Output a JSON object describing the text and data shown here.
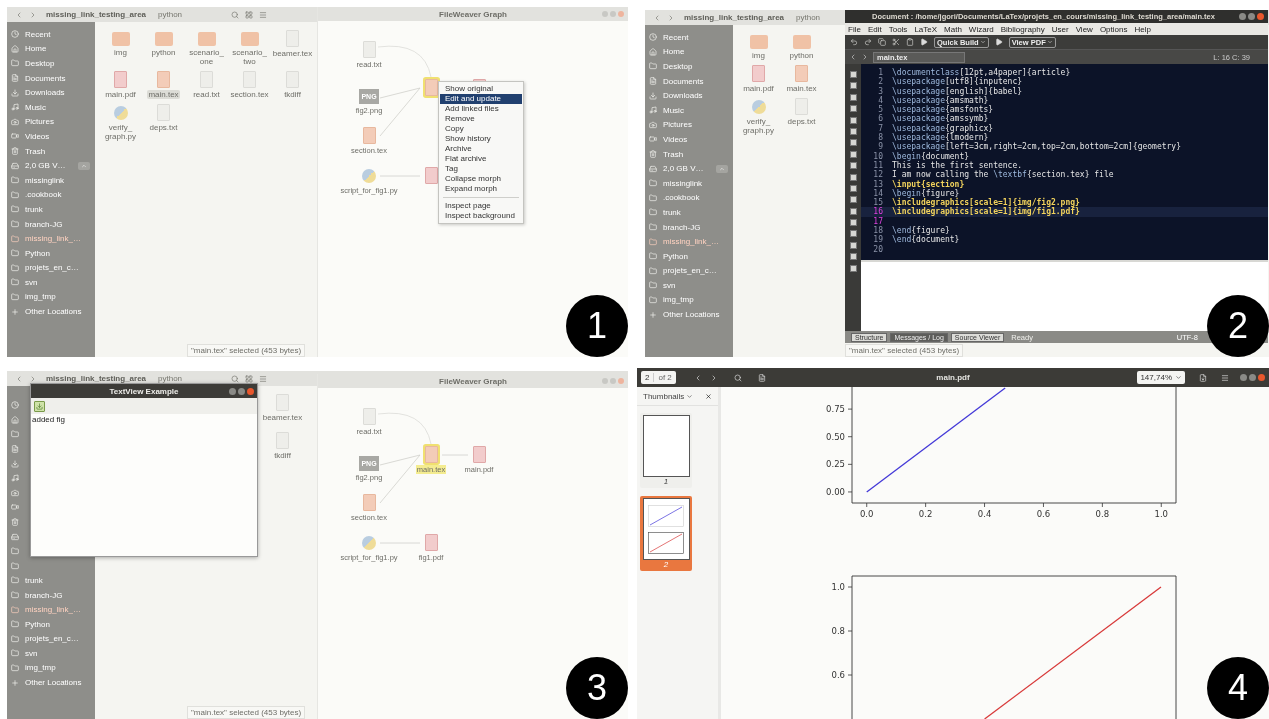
{
  "panels": [
    {
      "kind": "fileweaver",
      "badge": "1",
      "file_manager": {
        "path": [
          "missing_link_testing_area",
          "python"
        ],
        "sidebar": [
          {
            "kind": "place",
            "label": "Recent",
            "selected": false
          },
          {
            "kind": "place",
            "label": "Home",
            "selected": false
          },
          {
            "kind": "place",
            "label": "Desktop",
            "selected": false
          },
          {
            "kind": "place",
            "label": "Documents",
            "selected": false
          },
          {
            "kind": "place",
            "label": "Downloads",
            "selected": false
          },
          {
            "kind": "place",
            "label": "Music",
            "selected": false
          },
          {
            "kind": "place",
            "label": "Pictures",
            "selected": false
          },
          {
            "kind": "place",
            "label": "Videos",
            "selected": false
          },
          {
            "kind": "place",
            "label": "Trash",
            "selected": false
          },
          {
            "kind": "drive",
            "label": "2,0 GB V…",
            "selected": false
          },
          {
            "kind": "folder",
            "label": "missinglink",
            "selected": false
          },
          {
            "kind": "folder",
            "label": ".cookbook",
            "selected": false
          },
          {
            "kind": "folder",
            "label": "trunk",
            "selected": false
          },
          {
            "kind": "folder",
            "label": "branch-JG",
            "selected": false
          },
          {
            "kind": "folder",
            "label": "missing_link_…",
            "selected": true
          },
          {
            "kind": "folder",
            "label": "Python",
            "selected": false
          },
          {
            "kind": "folder",
            "label": "projets_en_c…",
            "selected": false
          },
          {
            "kind": "folder",
            "label": "svn",
            "selected": false
          },
          {
            "kind": "folder",
            "label": "img_tmp",
            "selected": false
          },
          {
            "kind": "add",
            "label": "Other Locations",
            "selected": false
          }
        ],
        "files": [
          {
            "kind": "folder",
            "name": "img",
            "selected": false
          },
          {
            "kind": "folder",
            "name": "python",
            "selected": false
          },
          {
            "kind": "folder",
            "name": "scenario_ one",
            "selected": false
          },
          {
            "kind": "folder",
            "name": "scenario_ two",
            "selected": false
          },
          {
            "kind": "text",
            "name": "beamer.tex",
            "selected": false
          },
          {
            "kind": "pdf",
            "name": "main.pdf",
            "selected": false
          },
          {
            "kind": "tex",
            "name": "main.tex",
            "selected": true
          },
          {
            "kind": "text",
            "name": "read.txt",
            "selected": false
          },
          {
            "kind": "text",
            "name": "section.tex",
            "selected": false
          },
          {
            "kind": "text",
            "name": "tkdiff",
            "selected": false
          },
          {
            "kind": "python",
            "name": "verify_ graph.py",
            "selected": false
          },
          {
            "kind": "text",
            "name": "deps.txt",
            "selected": false
          }
        ],
        "status": "\"main.tex\" selected (453 bytes)"
      },
      "graph_window": {
        "title": "FileWeaver Graph",
        "nodes": [
          {
            "kind": "text",
            "label": "read.txt",
            "selected": false
          },
          {
            "kind": "png",
            "badge": "PNG",
            "label": "fig2.png",
            "selected": false
          },
          {
            "kind": "tex",
            "selected": true
          },
          {
            "kind": "pdf",
            "selected": false
          },
          {
            "kind": "tex",
            "label": "section.tex",
            "selected": false
          },
          {
            "kind": "python",
            "label": "script_for_fig1.py",
            "selected": false
          },
          {
            "kind": "pdf",
            "selected": false
          }
        ],
        "menu": {
          "sections": [
            [
              {
                "label": "Show original",
                "selected": false
              },
              {
                "label": "Edit and update",
                "selected": true
              },
              {
                "label": "Add linked files",
                "selected": false
              },
              {
                "label": "Remove",
                "selected": false
              },
              {
                "label": "Copy",
                "selected": false
              },
              {
                "label": "Show history",
                "selected": false
              },
              {
                "label": "Archive",
                "selected": false
              },
              {
                "label": "Flat archive",
                "selected": false
              },
              {
                "label": "Tag",
                "selected": false
              },
              {
                "label": "Collapse morph",
                "selected": false
              },
              {
                "label": "Expand morph",
                "selected": false
              }
            ],
            [
              {
                "label": "Inspect page",
                "selected": false
              },
              {
                "label": "Inspect background",
                "selected": false
              }
            ]
          ]
        }
      }
    },
    {
      "kind": "texstudio",
      "badge": "2",
      "file_manager": {
        "path": [
          "missing_link_testing_area",
          "python"
        ],
        "sidebar": [
          {
            "kind": "place",
            "label": "Recent",
            "selected": false
          },
          {
            "kind": "place",
            "label": "Home",
            "selected": false
          },
          {
            "kind": "place",
            "label": "Desktop",
            "selected": false
          },
          {
            "kind": "place",
            "label": "Documents",
            "selected": false
          },
          {
            "kind": "place",
            "label": "Downloads",
            "selected": false
          },
          {
            "kind": "place",
            "label": "Music",
            "selected": false
          },
          {
            "kind": "place",
            "label": "Pictures",
            "selected": false
          },
          {
            "kind": "place",
            "label": "Videos",
            "selected": false
          },
          {
            "kind": "place",
            "label": "Trash",
            "selected": false
          },
          {
            "kind": "drive",
            "label": "2,0 GB V…",
            "selected": false
          },
          {
            "kind": "folder",
            "label": "missinglink",
            "selected": false
          },
          {
            "kind": "folder",
            "label": ".cookbook",
            "selected": false
          },
          {
            "kind": "folder",
            "label": "trunk",
            "selected": false
          },
          {
            "kind": "folder",
            "label": "branch-JG",
            "selected": false
          },
          {
            "kind": "folder",
            "label": "missing_link_…",
            "selected": true
          },
          {
            "kind": "folder",
            "label": "Python",
            "selected": false
          },
          {
            "kind": "folder",
            "label": "projets_en_c…",
            "selected": false
          },
          {
            "kind": "folder",
            "label": "svn",
            "selected": false
          },
          {
            "kind": "folder",
            "label": "img_tmp",
            "selected": false
          },
          {
            "kind": "add",
            "label": "Other Locations",
            "selected": false
          }
        ],
        "files": [
          {
            "kind": "folder",
            "name": "img",
            "selected": false
          },
          {
            "kind": "folder",
            "name": "python",
            "selected": false
          },
          {
            "kind": "pdf",
            "name": "main.pdf",
            "selected": false
          },
          {
            "kind": "tex",
            "name": "main.tex",
            "selected": false
          },
          {
            "kind": "python",
            "name": "verify_ graph.py",
            "selected": false
          },
          {
            "kind": "text",
            "name": "deps.txt",
            "selected": false
          }
        ],
        "status": "\"main.tex\" selected (453 bytes)"
      },
      "editor": {
        "title": "Document : /home/jgori/Documents/LaTex/projets_en_cours/missing_link_testing_area/main.tex",
        "menu": [
          "File",
          "Edit",
          "Tools",
          "LaTeX",
          "Math",
          "Wizard",
          "Bibliography",
          "User",
          "View",
          "Options",
          "Help"
        ],
        "buttons": [
          "Quick Build",
          "View PDF"
        ],
        "tab": "main.tex",
        "cursor": "L: 16 C: 39",
        "lines": [
          {
            "number": "1",
            "text": "\\documentclass[12pt,a4paper]{article}",
            "strong": false,
            "marked": false,
            "current": false
          },
          {
            "number": "2",
            "text": "\\usepackage[utf8]{inputenc}",
            "strong": false,
            "marked": false,
            "current": false
          },
          {
            "number": "3",
            "text": "\\usepackage[english]{babel}",
            "strong": false,
            "marked": false,
            "current": false
          },
          {
            "number": "4",
            "text": "\\usepackage{amsmath}",
            "strong": false,
            "marked": false,
            "current": false
          },
          {
            "number": "5",
            "text": "\\usepackage{amsfonts}",
            "strong": false,
            "marked": false,
            "current": false
          },
          {
            "number": "6",
            "text": "\\usepackage{amssymb}",
            "strong": false,
            "marked": false,
            "current": false
          },
          {
            "number": "7",
            "text": "\\usepackage{graphicx}",
            "strong": false,
            "marked": false,
            "current": false
          },
          {
            "number": "8",
            "text": "\\usepackage{lmodern}",
            "strong": false,
            "marked": false,
            "current": false
          },
          {
            "number": "9",
            "text": "\\usepackage[left=3cm,right=2cm,top=2cm,bottom=2cm]{geometry}",
            "strong": false,
            "marked": false,
            "current": false
          },
          {
            "number": "10",
            "text": "\\begin{document}",
            "strong": false,
            "marked": false,
            "current": false
          },
          {
            "number": "11",
            "text": "This is the first sentence.",
            "strong": false,
            "marked": false,
            "current": false
          },
          {
            "number": "12",
            "text": "I am now calling the \\textbf{section.tex} file",
            "strong": false,
            "marked": false,
            "current": false
          },
          {
            "number": "13",
            "text": "\\input{section}",
            "strong": true,
            "marked": false,
            "current": false
          },
          {
            "number": "14",
            "text": "\\begin{figure}",
            "strong": false,
            "marked": false,
            "current": false
          },
          {
            "number": "15",
            "text": "\\includegraphics[scale=1]{img/fig2.png}",
            "strong": true,
            "marked": false,
            "current": false
          },
          {
            "number": "16",
            "text": "\\includegraphics[scale=1]{img/fig1.pdf}",
            "strong": true,
            "marked": true,
            "current": true
          },
          {
            "number": "17",
            "marked": true,
            "current": false
          },
          {
            "number": "18",
            "text": "\\end{figure}",
            "strong": false,
            "marked": false,
            "current": false
          },
          {
            "number": "19",
            "text": "\\end{document}",
            "strong": false,
            "marked": false,
            "current": false
          },
          {
            "number": "20",
            "marked": false,
            "current": false
          }
        ],
        "log_tabs": [
          {
            "label": "Structure",
            "selected": false
          },
          {
            "label": "Messages / Log",
            "selected": true
          },
          {
            "label": "Source Viewer",
            "selected": false
          }
        ],
        "status": "Ready",
        "encoding": "UTF-8"
      }
    },
    {
      "kind": "textview",
      "badge": "3",
      "file_manager": {
        "path": [
          "missing_link_testing_area",
          "python"
        ],
        "sidebar": [
          {
            "kind": "place",
            "selected": false
          },
          {
            "kind": "place",
            "selected": false
          },
          {
            "kind": "place",
            "selected": false
          },
          {
            "kind": "place",
            "selected": false
          },
          {
            "kind": "place",
            "selected": false
          },
          {
            "kind": "place",
            "selected": false
          },
          {
            "kind": "place",
            "selected": false
          },
          {
            "kind": "place",
            "selected": false
          },
          {
            "kind": "place",
            "selected": false
          },
          {
            "kind": "drive",
            "selected": false
          },
          {
            "kind": "folder",
            "selected": false
          },
          {
            "kind": "folder",
            "selected": false
          },
          {
            "kind": "folder",
            "label": "trunk",
            "selected": false
          },
          {
            "kind": "folder",
            "label": "branch-JG",
            "selected": false
          },
          {
            "kind": "folder",
            "label": "missing_link_…",
            "selected": true
          },
          {
            "kind": "folder",
            "label": "Python",
            "selected": false
          },
          {
            "kind": "folder",
            "label": "projets_en_c…",
            "selected": false
          },
          {
            "kind": "folder",
            "label": "svn",
            "selected": false
          },
          {
            "kind": "folder",
            "label": "img_tmp",
            "selected": false
          },
          {
            "kind": "add",
            "label": "Other Locations",
            "selected": false
          }
        ],
        "files": [
          {
            "kind": "text",
            "name": "beamer.tex",
            "selected": false
          },
          {
            "kind": "text",
            "name": "tkdiff",
            "selected": false
          }
        ],
        "status": "\"main.tex\" selected (453 bytes)"
      },
      "dialog": {
        "title": "TextView Example",
        "text": "added fig"
      },
      "graph_window": {
        "title": "FileWeaver Graph",
        "nodes": [
          {
            "kind": "text",
            "label": "read.txt",
            "selected": false
          },
          {
            "kind": "png",
            "badge": "PNG",
            "label": "fig2.png",
            "selected": false
          },
          {
            "kind": "tex",
            "label": "main.tex",
            "selected": true
          },
          {
            "kind": "pdf",
            "label": "main.pdf",
            "selected": false
          },
          {
            "kind": "tex",
            "label": "section.tex",
            "selected": false
          },
          {
            "kind": "python",
            "label": "script_for_fig1.py",
            "selected": false
          },
          {
            "kind": "pdf",
            "label": "fig1.pdf",
            "selected": false
          }
        ]
      }
    },
    {
      "kind": "pdfviewer",
      "badge": "4",
      "viewer": {
        "page": "2",
        "page_count": "of 2",
        "title": "main.pdf",
        "zoom": "147,74%",
        "sidebar_mode": "Thumbnails",
        "thumbnails": [
          {
            "label": "1",
            "selected": false
          },
          {
            "label": "2",
            "selected": true
          }
        ],
        "charts": [
          {
            "chart_data": {
              "type": "line",
              "x": [
                0,
                0.47
              ],
              "series": [
                {
                  "color": "#4338d8",
                  "values": [
                    0,
                    0.94
                  ]
                }
              ],
              "xlim": [
                -0.05,
                1.05
              ],
              "ylim": [
                -0.1,
                0.95
              ],
              "xticks": [
                {
                  "value": 0,
                  "label": "0.0"
                },
                {
                  "value": 0.2,
                  "label": "0.2"
                },
                {
                  "value": 0.4,
                  "label": "0.4"
                },
                {
                  "value": 0.6,
                  "label": "0.6"
                },
                {
                  "value": 0.8,
                  "label": "0.8"
                },
                {
                  "value": 1,
                  "label": "1.0"
                }
              ],
              "yticks": [
                {
                  "value": 0,
                  "label": "0.00"
                },
                {
                  "value": 0.25,
                  "label": "0.25"
                },
                {
                  "value": 0.5,
                  "label": "0.50"
                },
                {
                  "value": 0.75,
                  "label": "0.75"
                }
              ]
            }
          },
          {
            "plot": {
              "ytick_labels": [
                "1.0",
                "0.8",
                "0.6"
              ]
            }
          }
        ]
      }
    }
  ]
}
